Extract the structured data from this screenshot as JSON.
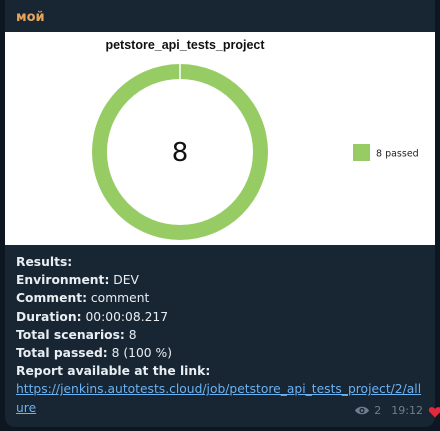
{
  "message": {
    "sender": "мой",
    "sender_color": "#e8a55a",
    "views": "2",
    "time": "19:12",
    "eye_icon": "eye-icon",
    "reaction_icon": "heart-icon",
    "reaction_color": "#e5283b",
    "link_color": "#6ab2f2"
  },
  "chart_data": {
    "type": "pie",
    "title": "petstore_api_tests_project",
    "center_label": "8",
    "legend_position": "right",
    "slices": [
      {
        "label": "8 passed",
        "value": 8,
        "color": "#97cc64"
      }
    ]
  },
  "results": {
    "heading": "Results:",
    "env_label": "Environment:",
    "env_value": "DEV",
    "comment_label": "Comment:",
    "comment_value": "comment",
    "duration_label": "Duration:",
    "duration_value": "00:00:08.217",
    "scenarios_label": "Total scenarios:",
    "scenarios_value": "8",
    "passed_label": "Total passed:",
    "passed_value": "8 (100 %)",
    "report_label": "Report available at the link:",
    "report_link": "https://jenkins.autotests.cloud/job/petstore_api_tests_project/2/allure"
  }
}
